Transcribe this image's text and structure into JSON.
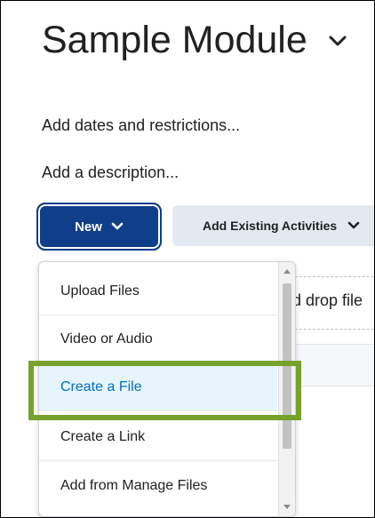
{
  "module": {
    "title": "Sample Module",
    "title_menu_icon": "chevron-down-icon",
    "add_dates_link": "Add dates and restrictions...",
    "add_description_link": "Add a description..."
  },
  "toolbar": {
    "new_label": "New",
    "new_icon": "chevron-down-icon",
    "existing_label": "Add Existing Activities",
    "existing_icon": "chevron-down-icon"
  },
  "dropzone": {
    "partial_text": "d drop file"
  },
  "new_menu": {
    "items": [
      {
        "label": "Upload Files"
      },
      {
        "label": "Video or Audio"
      },
      {
        "label": "Create a File",
        "highlighted": true
      },
      {
        "label": "Create a Link"
      },
      {
        "label": "Add from Manage Files"
      }
    ]
  },
  "annotation": {
    "highlight_color": "#76a22b"
  },
  "colors": {
    "primary_button": "#0f3f88",
    "secondary_button": "#e3e9f1",
    "selected_item_bg": "#e6f4fb",
    "selected_item_text": "#006fbf",
    "text": "#202122"
  }
}
